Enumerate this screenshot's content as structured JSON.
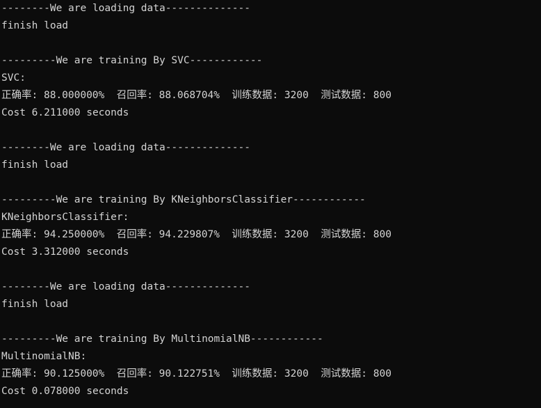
{
  "console": {
    "lines": [
      "--------We are loading data--------------",
      "finish load",
      "",
      "---------We are training By SVC------------",
      "SVC:",
      "正确率: 88.000000%  召回率: 88.068704%  训练数据: 3200  测试数据: 800",
      "Cost 6.211000 seconds",
      "",
      "--------We are loading data--------------",
      "finish load",
      "",
      "---------We are training By KNeighborsClassifier------------",
      "KNeighborsClassifier:",
      "正确率: 94.250000%  召回率: 94.229807%  训练数据: 3200  测试数据: 800",
      "Cost 3.312000 seconds",
      "",
      "--------We are loading data--------------",
      "finish load",
      "",
      "---------We are training By MultinomialNB------------",
      "MultinomialNB:",
      "正确率: 90.125000%  召回率: 90.122751%  训练数据: 3200  测试数据: 800",
      "Cost 0.078000 seconds"
    ]
  },
  "colors": {
    "background": "#0c0c0c",
    "text": "#d4d4d4"
  }
}
